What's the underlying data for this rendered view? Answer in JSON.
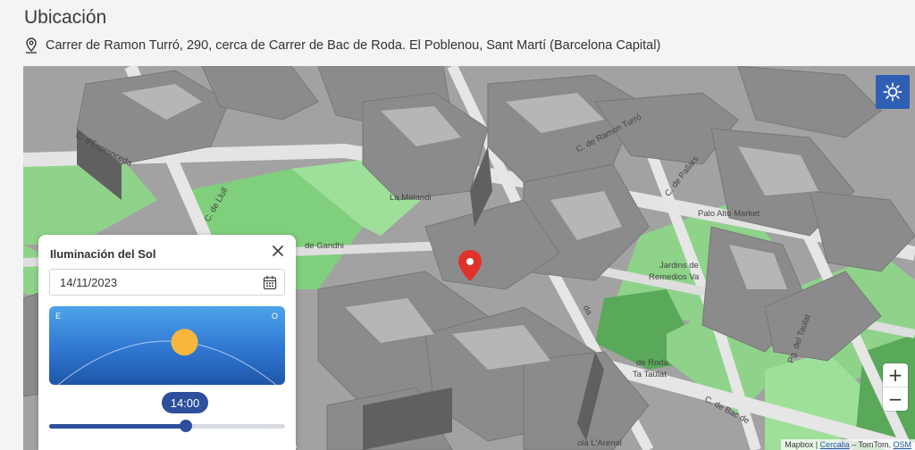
{
  "header": {
    "title": "Ubicación",
    "address": "Carrer de Ramon Turró, 290, cerca de Carrer de Bac de Roda. El Poblenou, Sant Martí (Barcelona Capital)"
  },
  "map": {
    "labels": {
      "c_espronceda": "C. d'Espronceda",
      "c_llull": "C. de Llull",
      "la_malandi": "La Malandi",
      "de_gandhi": "de Gandhi",
      "c_ramon_turro": "C. de Ramon Turró",
      "c_pallars": "C. de Pallars",
      "palo_alto": "Palo Alto Market",
      "jardins": "Jardins de",
      "remedios": "Remedios Va",
      "de_roda": "de Roda",
      "ta_taulat": "Ta Taulat",
      "pg_taulat": "Pg. del Taulat",
      "c_bac_roda": "C. de Bac de",
      "arenal": "ola L'Arenal",
      "da": "da"
    },
    "zoom_in": "+",
    "zoom_out": "−",
    "attribution": {
      "mapbox": "Mapbox | ",
      "cercalia": "Cercalia",
      "tomtom": " – TomTom, ",
      "osm": "OSM"
    },
    "sun_button_icon": "sun-icon",
    "marker_icon": "map-pin-icon"
  },
  "sun_panel": {
    "title": "Iluminación del Sol",
    "date_value": "14/11/2023",
    "east_label": "E",
    "west_label": "O",
    "time": "14:00",
    "slider_fraction": 0.58,
    "sun_arc_fraction": 0.58
  },
  "colors": {
    "accent": "#2e4f9c",
    "sun_button": "#2f5fb5",
    "sun": "#f6b73c",
    "marker": "#e0322b",
    "park": "#8fd38a"
  }
}
